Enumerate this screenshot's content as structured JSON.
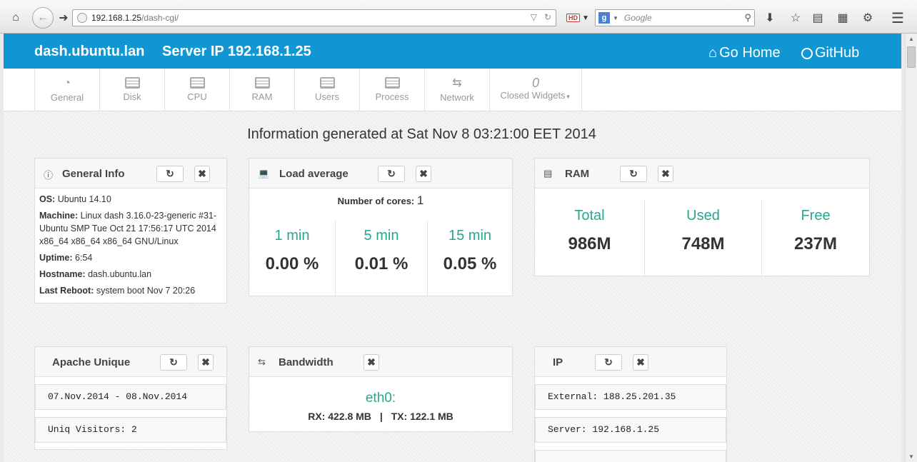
{
  "browser": {
    "url_host": "192.168.1.25",
    "url_path": "/dash-cgi/",
    "hd_label": "HD",
    "search_engine_letter": "g",
    "search_placeholder": "Google"
  },
  "navbar": {
    "brand": "dash.ubuntu.lan",
    "server_ip": "Server IP 192.168.1.25",
    "home_label": "Go Home",
    "github_label": "GitHub",
    "color": "#1196d4"
  },
  "tabs": [
    {
      "label": "General",
      "icon": "dashboard-icon"
    },
    {
      "label": "Disk",
      "icon": "widget-icon"
    },
    {
      "label": "CPU",
      "icon": "widget-icon"
    },
    {
      "label": "RAM",
      "icon": "widget-icon"
    },
    {
      "label": "Users",
      "icon": "widget-icon"
    },
    {
      "label": "Process",
      "icon": "widget-icon"
    },
    {
      "label": "Network",
      "icon": "exchange-icon"
    }
  ],
  "closed_widgets": {
    "count": "0",
    "label": "Closed Widgets"
  },
  "generated_text": "Information generated at Sat Nov 8 03:21:00 EET 2014",
  "general_info": {
    "title": "General Info",
    "os_label": "OS:",
    "os": "Ubuntu 14.10",
    "machine_label": "Machine:",
    "machine": "Linux dash 3.16.0-23-generic #31-Ubuntu SMP Tue Oct 21 17:56:17 UTC 2014 x86_64 x86_64 x86_64 GNU/Linux",
    "uptime_label": "Uptime:",
    "uptime": "6:54",
    "hostname_label": "Hostname:",
    "hostname": "dash.ubuntu.lan",
    "reboot_label": "Last Reboot:",
    "reboot": "system boot Nov 7 20:26"
  },
  "load_average": {
    "title": "Load average",
    "cores_label": "Number of cores:",
    "cores": "1",
    "columns": [
      {
        "label": "1 min",
        "value": "0.00 %"
      },
      {
        "label": "5 min",
        "value": "0.01 %"
      },
      {
        "label": "15 min",
        "value": "0.05 %"
      }
    ]
  },
  "ram": {
    "title": "RAM",
    "columns": [
      {
        "label": "Total",
        "value": "986M"
      },
      {
        "label": "Used",
        "value": "748M"
      },
      {
        "label": "Free",
        "value": "237M"
      }
    ]
  },
  "apache": {
    "title": "Apache Unique",
    "rows": [
      "07.Nov.2014 - 08.Nov.2014",
      "Uniq Visitors: 2"
    ]
  },
  "bandwidth": {
    "title": "Bandwidth",
    "iface": "eth0:",
    "rx": "RX: 422.8 MB",
    "sep": "|",
    "tx": "TX: 122.1 MB"
  },
  "ip": {
    "title": "IP",
    "rows": [
      "External: 188.25.201.35",
      "Server: 192.168.1.25"
    ]
  }
}
